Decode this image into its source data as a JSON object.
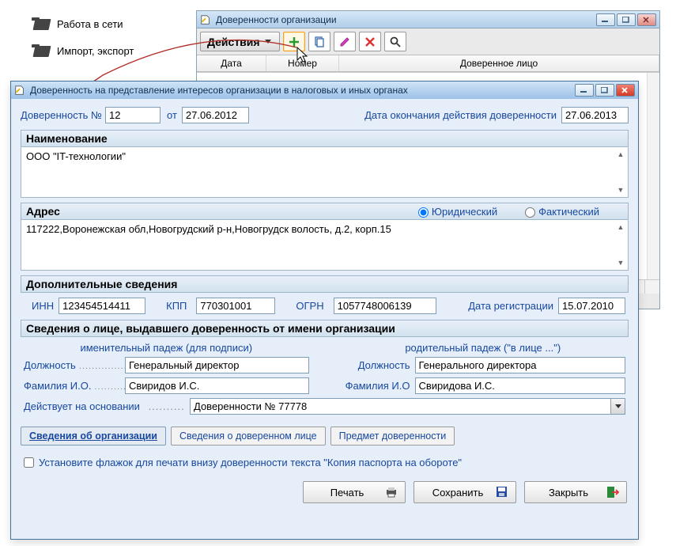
{
  "sidebar": {
    "items": [
      {
        "label": "Работа в сети"
      },
      {
        "label": "Импорт, экспорт"
      }
    ]
  },
  "parent_window": {
    "title": "Доверенности организации",
    "actions_label": "Действия",
    "columns": {
      "c1": "Дата",
      "c2": "Номер",
      "c3": "Доверенное лицо"
    }
  },
  "dialog": {
    "title": "Доверенность на представление интересов организации в налоговых и иных органах",
    "top": {
      "number_label": "Доверенность №",
      "number_value": "12",
      "from_label": "от",
      "from_date": "27.06.2012",
      "expire_label": "Дата окончания действия доверенности",
      "expire_date": "27.06.2013"
    },
    "name_section": {
      "header": "Наименование",
      "value": "ООО \"IT-технологии\""
    },
    "addr_section": {
      "header": "Адрес",
      "r_legal": "Юридический",
      "r_actual": "Фактический",
      "value": "117222,Воронежская обл,Новогрудский р-н,Новогрудск волость, д.2, корп.15"
    },
    "extra_section": {
      "header": "Дополнительные сведения",
      "inn_label": "ИНН",
      "inn": "123454514411",
      "kpp_label": "КПП",
      "kpp": "770301001",
      "ogrn_label": "ОГРН",
      "ogrn": "1057748006139",
      "reg_label": "Дата регистрации",
      "reg": "15.07.2010"
    },
    "issuer_section": {
      "header": "Сведения о лице, выдавшего доверенность от имени организации",
      "hint_nom": "именительный падеж (для подписи)",
      "hint_gen": "родительный падеж (\"в лице ...\")",
      "pos_label": "Должность",
      "pos_nom": "Генеральный директор",
      "pos_gen": "Генерального директора",
      "fio_label_nom": "Фамилия И.О.",
      "fio_label_gen": "Фамилия И.О",
      "fio_nom": "Свиридов И.С.",
      "fio_gen": "Свиридова И.С.",
      "basis_label": "Действует на основании",
      "basis_value": "Доверенности № 77778"
    },
    "tabs": {
      "t1": "Сведения об организации",
      "t2": "Сведения о доверенном лице",
      "t3": "Предмет доверенности"
    },
    "checkbox_label": "Установите флажок для печати внизу доверенности текста \"Копия паспорта на обороте\"",
    "buttons": {
      "print": "Печать",
      "save": "Сохранить",
      "close": "Закрыть"
    }
  }
}
